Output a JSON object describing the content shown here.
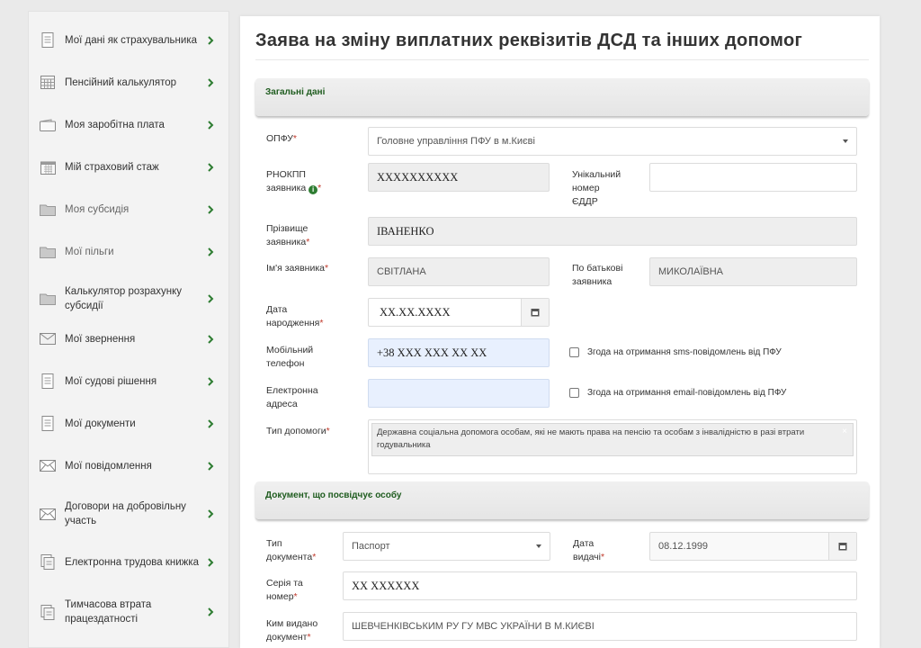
{
  "sidebar": {
    "items": [
      {
        "label": "Мої дані як страхувальника",
        "icon": "document-icon"
      },
      {
        "label": "Пенсійний калькулятор",
        "icon": "calculator-icon"
      },
      {
        "label": "Моя заробітна плата",
        "icon": "wallet-icon"
      },
      {
        "label": "Мій страховий стаж",
        "icon": "calendar-icon"
      },
      {
        "label": "Моя субсидія",
        "icon": "folder-icon"
      },
      {
        "label": "Мої пільги",
        "icon": "folder-icon"
      },
      {
        "label": "Калькулятор розрахунку субсидії",
        "icon": "folder-icon"
      },
      {
        "label": "Мої звернення",
        "icon": "envelope-icon"
      },
      {
        "label": "Мої судові рішення",
        "icon": "document-icon"
      },
      {
        "label": "Мої документи",
        "icon": "document-icon"
      },
      {
        "label": "Мої повідомлення",
        "icon": "envelope-icon"
      },
      {
        "label": "Договори на добровільну участь",
        "icon": "envelope-icon"
      },
      {
        "label": "Електронна трудова книжка",
        "icon": "workbook-icon"
      },
      {
        "label": "Тимчасова втрата працездатності",
        "icon": "workbook-icon"
      }
    ]
  },
  "main": {
    "title": "Заява на зміну виплатних реквізитів ДСД та інших допомог",
    "sections": {
      "general": "Загальні дані",
      "document": "Документ, що посвідчує особу"
    },
    "form": {
      "opfu": {
        "label": "ОПФУ",
        "value": "Головне управління ПФУ в м.Києві"
      },
      "rnokpp": {
        "label_line1": "РНОКПП",
        "label_line2": "заявника",
        "value": "XXXXXXXXXX"
      },
      "eddr": {
        "label_line1": "Унікальний",
        "label_line2": "номер",
        "label_line3": "ЄДДР",
        "value": ""
      },
      "surname": {
        "label_line1": "Прізвище",
        "label_line2": "заявника",
        "value": "ІВАНЕНКО"
      },
      "name": {
        "label": "Ім'я заявника",
        "value": "СВІТЛАНА"
      },
      "patronymic": {
        "label_line1": "По батькові",
        "label_line2": "заявника",
        "value": "МИКОЛАЇВНА"
      },
      "birth_date": {
        "label_line1": "Дата",
        "label_line2": "народження",
        "value": "XX.XX.XXXX"
      },
      "phone": {
        "label_line1": "Мобільний",
        "label_line2": "телефон",
        "value": "+38 XXX XXX XX XX"
      },
      "email": {
        "label_line1": "Електронна",
        "label_line2": "адреса",
        "value": ""
      },
      "sms_consent": "Згода на отримання sms-повідомлень від ПФУ",
      "email_consent": "Згода на отримання email-повідомлень від ПФУ",
      "aid_type": {
        "label": "Тип допомоги",
        "value": "Державна соціальна допомога особам, які не мають права на пенсію та особам з інвалідністю в разі втрати годувальника",
        "remove_glyph": "×"
      },
      "doc_type": {
        "label_line1": "Тип",
        "label_line2": "документа",
        "value": "Паспорт"
      },
      "issue_date": {
        "label_line1": "Дата",
        "label_line2": "видачі",
        "value": "08.12.1999"
      },
      "series": {
        "label_line1": "Серія та",
        "label_line2": "номер",
        "value": "XX XXXXXX"
      },
      "issued_by": {
        "label_line1": "Ким видано",
        "label_line2": "документ",
        "value": "ШЕВЧЕНКІВСЬКИМ РУ ГУ МВС УКРАЇНИ В М.КИЄВІ"
      }
    }
  },
  "colors": {
    "accent": "#2e7d32",
    "section_text": "#1f5c1f",
    "required": "#c0392b",
    "highlight": "#e8f0fe"
  }
}
